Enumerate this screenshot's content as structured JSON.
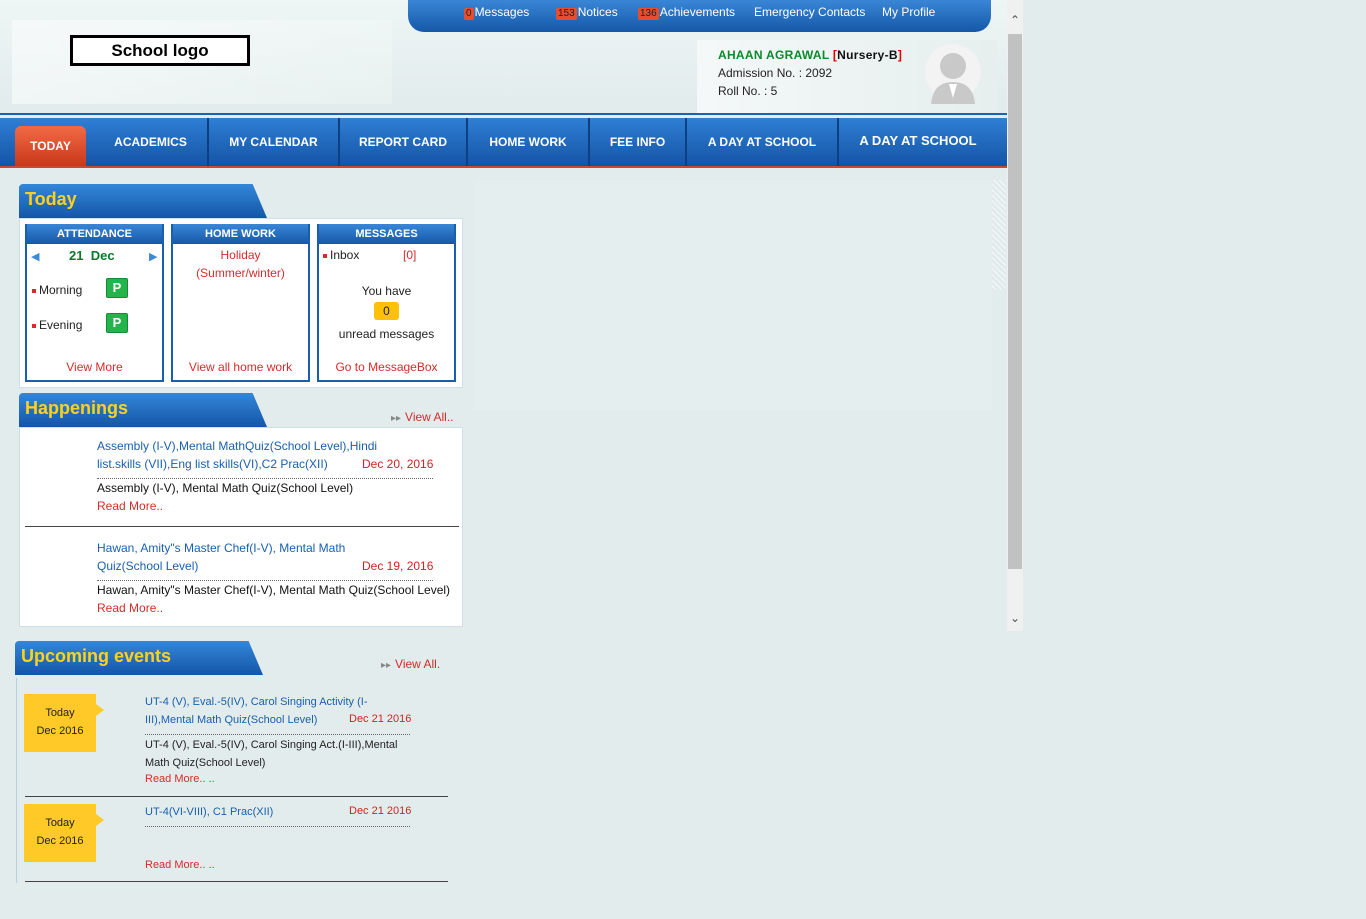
{
  "header": {
    "logo_text": "School logo",
    "top_links": [
      {
        "count": "0",
        "label": "Messages"
      },
      {
        "count": "153",
        "label": "Notices"
      },
      {
        "count": "136",
        "label": "Achievements"
      },
      {
        "count": "",
        "label": "Emergency Contacts"
      },
      {
        "count": "",
        "label": "My Profile"
      }
    ]
  },
  "profile": {
    "name": "AHAAN AGRAWAL",
    "class_open": "[",
    "class": "Nursery-B",
    "class_close": "]",
    "admission": "Admission No. : 2092",
    "roll": "Roll No. : 5"
  },
  "nav": {
    "items": [
      "TODAY",
      "ACADEMICS",
      "MY CALENDAR",
      "REPORT CARD",
      "HOME WORK",
      "FEE INFO",
      "A DAY AT SCHOOL",
      "A DAY AT SCHOOL"
    ]
  },
  "today": {
    "title": "Today",
    "attendance": {
      "header": "ATTENDANCE",
      "day": "21",
      "month": "Dec",
      "morning_label": "Morning",
      "morning_status": "P",
      "evening_label": "Evening",
      "evening_status": "P",
      "link": "View More"
    },
    "homework": {
      "header": "HOME WORK",
      "line1": "Holiday",
      "line2": "(Summer/winter)",
      "link": "View all home work"
    },
    "messages": {
      "header": "MESSAGES",
      "inbox_label": "Inbox",
      "inbox_count": "[0]",
      "you_have": "You have",
      "unread_count": "0",
      "unread_label": "unread messages",
      "link": "Go to MessageBox"
    }
  },
  "happenings": {
    "title": "Happenings",
    "view_all": "View All..",
    "items": [
      {
        "title": "Assembly (I-V),Mental MathQuiz(School Level),Hindi list.skills (VII),Eng list skills(VI),C2 Prac(XII)",
        "date": "Dec 20, 2016",
        "desc": "Assembly (I-V), Mental Math Quiz(School Level)",
        "read_more": "Read More.."
      },
      {
        "title": "Hawan, Amity\"s Master Chef(I-V), Mental Math Quiz(School Level)",
        "date": "Dec 19, 2016",
        "desc": "Hawan, Amity\"s Master Chef(I-V), Mental Math Quiz(School Level)",
        "read_more": "Read More.."
      }
    ]
  },
  "upcoming": {
    "title": "Upcoming events",
    "view_all": "View All.",
    "items": [
      {
        "tag_line1": "Today",
        "tag_line2": "Dec 2016",
        "title": "UT-4 (V), Eval.-5(IV), Carol Singing Activity (I-III),Mental Math Quiz(School Level)",
        "date": "Dec 21  2016",
        "desc": "UT-4 (V), Eval.-5(IV), Carol Singing Act.(I-III),Mental Math Quiz(School Level)",
        "read_more": "Read More.. .."
      },
      {
        "tag_line1": "Today",
        "tag_line2": "Dec 2016",
        "title": "UT-4(VI-VIII), C1 Prac(XII)",
        "date": "Dec 21  2016",
        "desc": "",
        "read_more": "Read More.. .."
      }
    ]
  },
  "colors": {
    "nav_blue": "#1558a8",
    "active_tab": "#e35a35",
    "title_yellow": "#ffd21a",
    "link_red": "#d82b2b",
    "present_green": "#25b34b"
  }
}
